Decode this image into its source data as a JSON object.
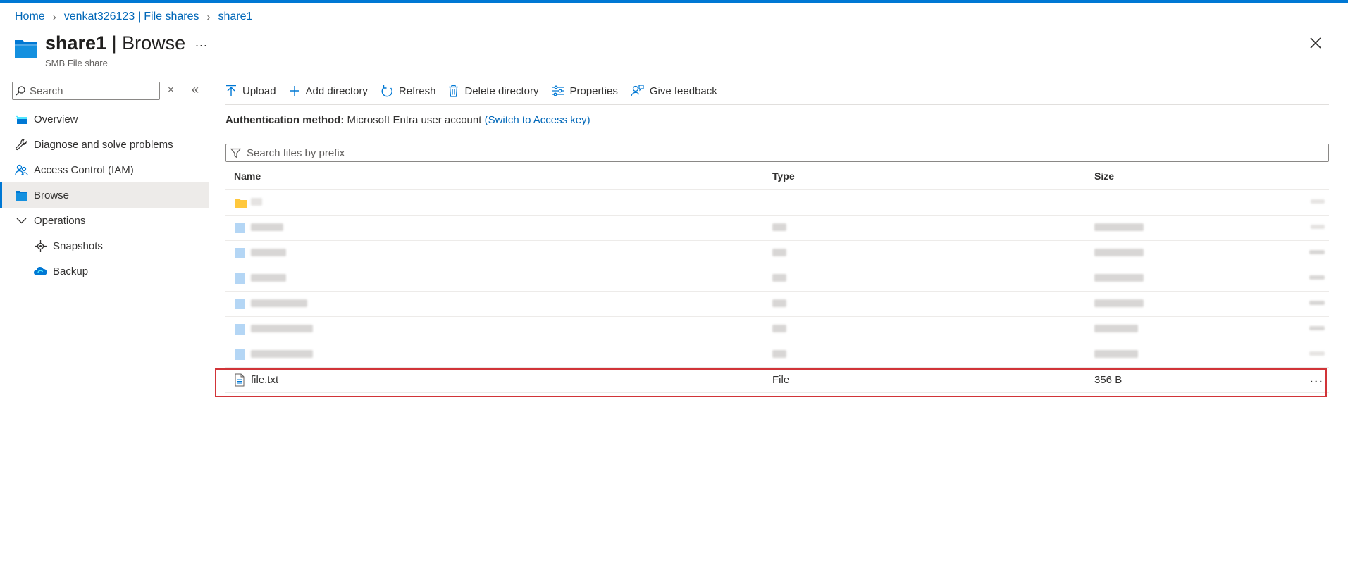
{
  "breadcrumb": [
    "Home",
    "venkat326123 | File shares",
    "share1"
  ],
  "page": {
    "name": "share1",
    "separator": " | ",
    "section": "Browse",
    "subtitle": "SMB File share",
    "more": "..."
  },
  "sidebar": {
    "search_placeholder": "Search",
    "items": [
      {
        "label": "Overview",
        "icon": "overview-icon"
      },
      {
        "label": "Diagnose and solve problems",
        "icon": "wrench-icon"
      },
      {
        "label": "Access Control (IAM)",
        "icon": "people-icon"
      },
      {
        "label": "Browse",
        "icon": "folder-icon",
        "active": true
      },
      {
        "label": "Operations",
        "icon": "chevron-down-icon"
      },
      {
        "label": "Snapshots",
        "icon": "snapshot-icon"
      },
      {
        "label": "Backup",
        "icon": "backup-icon"
      }
    ]
  },
  "toolbar": {
    "upload": "Upload",
    "add_directory": "Add directory",
    "refresh": "Refresh",
    "delete_directory": "Delete directory",
    "properties": "Properties",
    "give_feedback": "Give feedback"
  },
  "auth": {
    "label": "Authentication method:",
    "value": "Microsoft Entra user account",
    "switch_link": "(Switch to Access key)"
  },
  "filter": {
    "placeholder": "Search files by prefix"
  },
  "table": {
    "columns": [
      "Name",
      "Type",
      "Size"
    ],
    "visible_row": {
      "name": "file.txt",
      "type": "File",
      "size": "356 B",
      "more": "..."
    }
  },
  "colors": {
    "accent": "#0078d4",
    "link": "#0067b8",
    "highlight": "#d13438",
    "folder": "#ffc83d"
  }
}
